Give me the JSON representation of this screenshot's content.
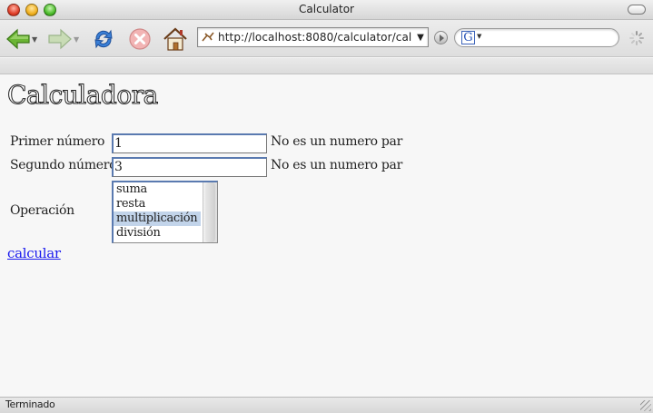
{
  "window": {
    "title": "Calculator"
  },
  "toolbar": {
    "back_icon": "back-arrow-icon",
    "forward_icon": "forward-arrow-icon",
    "reload_icon": "reload-icon",
    "stop_icon": "stop-icon",
    "home_icon": "home-icon",
    "url": "http://localhost:8080/calculator/cal",
    "url_dropdown": "▼",
    "search_engine_letter": "G"
  },
  "page": {
    "title": "Calculadora",
    "fields": [
      {
        "label": "Primer número",
        "value": "1",
        "message": "No es un numero par"
      },
      {
        "label": "Segundo número",
        "value": "3",
        "message": "No es un numero par"
      }
    ],
    "operation": {
      "label": "Operación",
      "options": [
        "suma",
        "resta",
        "multiplicación",
        "división"
      ],
      "selected": "multiplicación"
    },
    "submit_link": "calcular"
  },
  "status": {
    "text": "Terminado"
  },
  "colors": {
    "link": "#1a1aee",
    "selection": "#c2d4ea",
    "back_arrow": "#5aa02c",
    "stop": "#e8b0b0"
  }
}
